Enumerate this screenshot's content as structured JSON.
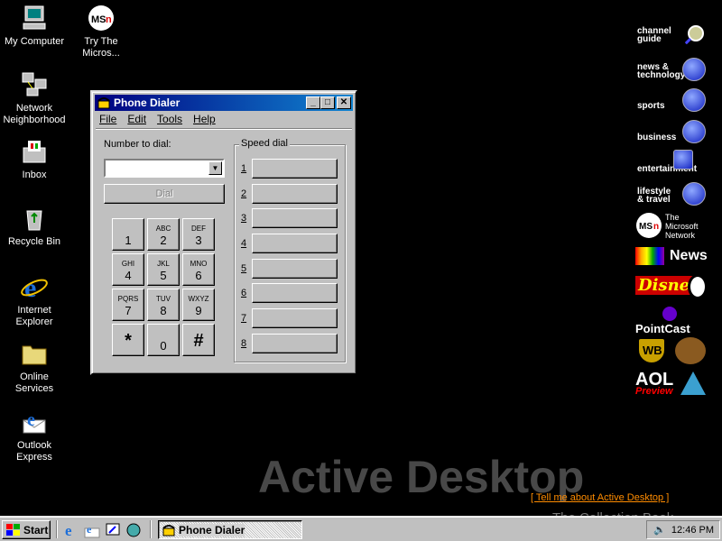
{
  "desktop": {
    "icons": [
      {
        "label": "My Computer"
      },
      {
        "label": "Try The Micros..."
      },
      {
        "label": "Network Neighborhood"
      },
      {
        "label": "Inbox"
      },
      {
        "label": "Recycle Bin"
      },
      {
        "label": "Internet Explorer"
      },
      {
        "label": "Online Services"
      },
      {
        "label": "Outlook Express"
      }
    ],
    "watermark": "Active Desktop",
    "tell_me": "[ Tell me about Active Desktop ]",
    "credit": "The Collection Book"
  },
  "channels": {
    "items": [
      {
        "label": "channel guide"
      },
      {
        "label": "news & technology"
      },
      {
        "label": "sports"
      },
      {
        "label": "business"
      },
      {
        "label": "entertainment"
      },
      {
        "label": "lifestyle & travel"
      }
    ],
    "logos": {
      "msn": "The Microsoft Network",
      "msnbc": "News",
      "disney": "Disney",
      "pointcast": "PointCast",
      "wb": "WB",
      "aol": "AOL",
      "aol_sub": "Preview"
    }
  },
  "window": {
    "title": "Phone Dialer",
    "menu": [
      "File",
      "Edit",
      "Tools",
      "Help"
    ],
    "number_label": "Number to dial:",
    "number_value": "",
    "dial_label": "Dial",
    "keys": [
      {
        "sub": "",
        "num": "1"
      },
      {
        "sub": "ABC",
        "num": "2"
      },
      {
        "sub": "DEF",
        "num": "3"
      },
      {
        "sub": "GHI",
        "num": "4"
      },
      {
        "sub": "JKL",
        "num": "5"
      },
      {
        "sub": "MNO",
        "num": "6"
      },
      {
        "sub": "PQRS",
        "num": "7"
      },
      {
        "sub": "TUV",
        "num": "8"
      },
      {
        "sub": "WXYZ",
        "num": "9"
      },
      {
        "sub": "",
        "num": "*"
      },
      {
        "sub": "",
        "num": "0"
      },
      {
        "sub": "",
        "num": "#"
      }
    ],
    "speed_dial_title": "Speed dial",
    "speed_dial": [
      "1",
      "2",
      "3",
      "4",
      "5",
      "6",
      "7",
      "8"
    ]
  },
  "taskbar": {
    "start": "Start",
    "task": "Phone Dialer",
    "clock": "12:46 PM"
  }
}
